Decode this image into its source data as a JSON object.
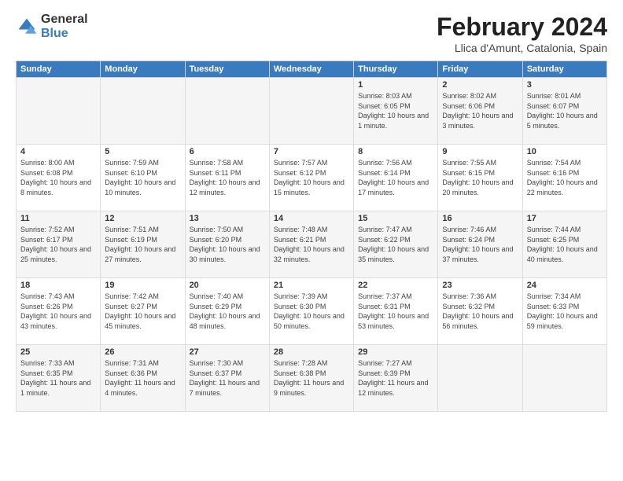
{
  "logo": {
    "general": "General",
    "blue": "Blue"
  },
  "header": {
    "title": "February 2024",
    "location": "Llica d'Amunt, Catalonia, Spain"
  },
  "columns": [
    "Sunday",
    "Monday",
    "Tuesday",
    "Wednesday",
    "Thursday",
    "Friday",
    "Saturday"
  ],
  "weeks": [
    [
      {
        "day": "",
        "info": ""
      },
      {
        "day": "",
        "info": ""
      },
      {
        "day": "",
        "info": ""
      },
      {
        "day": "",
        "info": ""
      },
      {
        "day": "1",
        "info": "Sunrise: 8:03 AM\nSunset: 6:05 PM\nDaylight: 10 hours\nand 1 minute."
      },
      {
        "day": "2",
        "info": "Sunrise: 8:02 AM\nSunset: 6:06 PM\nDaylight: 10 hours\nand 3 minutes."
      },
      {
        "day": "3",
        "info": "Sunrise: 8:01 AM\nSunset: 6:07 PM\nDaylight: 10 hours\nand 5 minutes."
      }
    ],
    [
      {
        "day": "4",
        "info": "Sunrise: 8:00 AM\nSunset: 6:08 PM\nDaylight: 10 hours\nand 8 minutes."
      },
      {
        "day": "5",
        "info": "Sunrise: 7:59 AM\nSunset: 6:10 PM\nDaylight: 10 hours\nand 10 minutes."
      },
      {
        "day": "6",
        "info": "Sunrise: 7:58 AM\nSunset: 6:11 PM\nDaylight: 10 hours\nand 12 minutes."
      },
      {
        "day": "7",
        "info": "Sunrise: 7:57 AM\nSunset: 6:12 PM\nDaylight: 10 hours\nand 15 minutes."
      },
      {
        "day": "8",
        "info": "Sunrise: 7:56 AM\nSunset: 6:14 PM\nDaylight: 10 hours\nand 17 minutes."
      },
      {
        "day": "9",
        "info": "Sunrise: 7:55 AM\nSunset: 6:15 PM\nDaylight: 10 hours\nand 20 minutes."
      },
      {
        "day": "10",
        "info": "Sunrise: 7:54 AM\nSunset: 6:16 PM\nDaylight: 10 hours\nand 22 minutes."
      }
    ],
    [
      {
        "day": "11",
        "info": "Sunrise: 7:52 AM\nSunset: 6:17 PM\nDaylight: 10 hours\nand 25 minutes."
      },
      {
        "day": "12",
        "info": "Sunrise: 7:51 AM\nSunset: 6:19 PM\nDaylight: 10 hours\nand 27 minutes."
      },
      {
        "day": "13",
        "info": "Sunrise: 7:50 AM\nSunset: 6:20 PM\nDaylight: 10 hours\nand 30 minutes."
      },
      {
        "day": "14",
        "info": "Sunrise: 7:48 AM\nSunset: 6:21 PM\nDaylight: 10 hours\nand 32 minutes."
      },
      {
        "day": "15",
        "info": "Sunrise: 7:47 AM\nSunset: 6:22 PM\nDaylight: 10 hours\nand 35 minutes."
      },
      {
        "day": "16",
        "info": "Sunrise: 7:46 AM\nSunset: 6:24 PM\nDaylight: 10 hours\nand 37 minutes."
      },
      {
        "day": "17",
        "info": "Sunrise: 7:44 AM\nSunset: 6:25 PM\nDaylight: 10 hours\nand 40 minutes."
      }
    ],
    [
      {
        "day": "18",
        "info": "Sunrise: 7:43 AM\nSunset: 6:26 PM\nDaylight: 10 hours\nand 43 minutes."
      },
      {
        "day": "19",
        "info": "Sunrise: 7:42 AM\nSunset: 6:27 PM\nDaylight: 10 hours\nand 45 minutes."
      },
      {
        "day": "20",
        "info": "Sunrise: 7:40 AM\nSunset: 6:29 PM\nDaylight: 10 hours\nand 48 minutes."
      },
      {
        "day": "21",
        "info": "Sunrise: 7:39 AM\nSunset: 6:30 PM\nDaylight: 10 hours\nand 50 minutes."
      },
      {
        "day": "22",
        "info": "Sunrise: 7:37 AM\nSunset: 6:31 PM\nDaylight: 10 hours\nand 53 minutes."
      },
      {
        "day": "23",
        "info": "Sunrise: 7:36 AM\nSunset: 6:32 PM\nDaylight: 10 hours\nand 56 minutes."
      },
      {
        "day": "24",
        "info": "Sunrise: 7:34 AM\nSunset: 6:33 PM\nDaylight: 10 hours\nand 59 minutes."
      }
    ],
    [
      {
        "day": "25",
        "info": "Sunrise: 7:33 AM\nSunset: 6:35 PM\nDaylight: 11 hours\nand 1 minute."
      },
      {
        "day": "26",
        "info": "Sunrise: 7:31 AM\nSunset: 6:36 PM\nDaylight: 11 hours\nand 4 minutes."
      },
      {
        "day": "27",
        "info": "Sunrise: 7:30 AM\nSunset: 6:37 PM\nDaylight: 11 hours\nand 7 minutes."
      },
      {
        "day": "28",
        "info": "Sunrise: 7:28 AM\nSunset: 6:38 PM\nDaylight: 11 hours\nand 9 minutes."
      },
      {
        "day": "29",
        "info": "Sunrise: 7:27 AM\nSunset: 6:39 PM\nDaylight: 11 hours\nand 12 minutes."
      },
      {
        "day": "",
        "info": ""
      },
      {
        "day": "",
        "info": ""
      }
    ]
  ]
}
